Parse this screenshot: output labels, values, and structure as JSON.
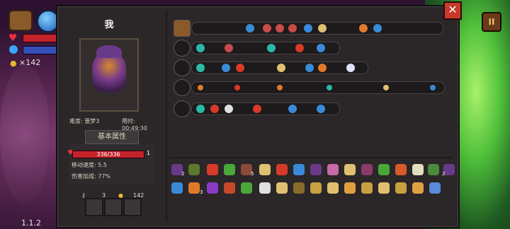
{
  "character": {
    "name": "我",
    "difficulty": "难度: 噩梦3",
    "time": "用时: 00:49:30"
  },
  "tabs": {
    "attributes": "基本属性"
  },
  "stats": {
    "hp_text": "336/336",
    "level": "1",
    "move_speed": "移动速度: 5.5",
    "damage_bonus": "伤害加成: 77%"
  },
  "resources": {
    "keys": "3",
    "coins": "142"
  },
  "hud": {
    "coins": "×142",
    "close": "✕",
    "pause": "II"
  },
  "version": "1.1.2",
  "item_counts": {
    "i1": "2",
    "i5": "5",
    "i17": "2",
    "i20": "3"
  }
}
